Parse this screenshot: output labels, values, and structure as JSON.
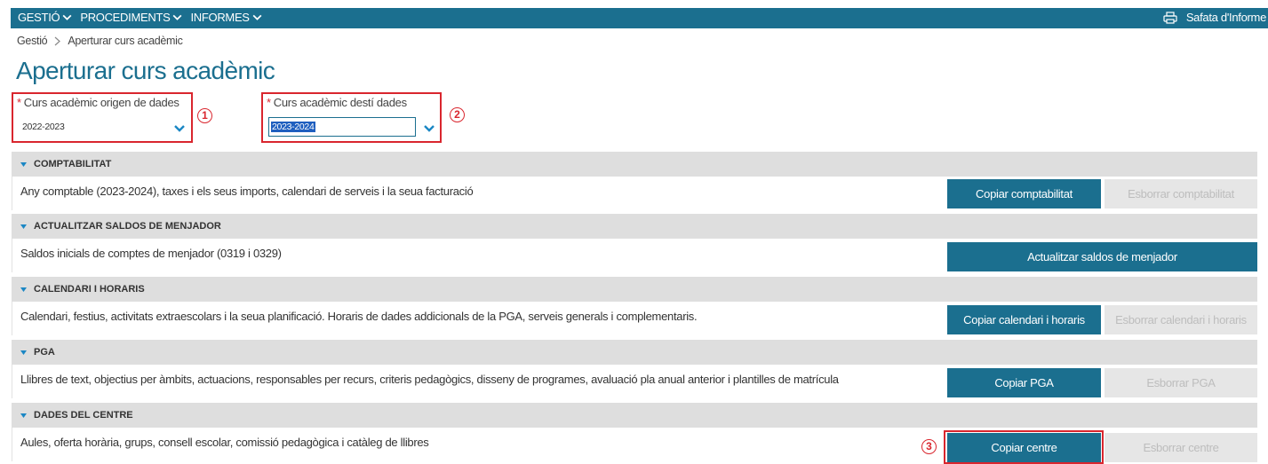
{
  "menu": {
    "items": [
      {
        "label": "GESTIÓ"
      },
      {
        "label": "PROCEDIMENTS"
      },
      {
        "label": "INFORMES"
      }
    ],
    "tray_label": "Safata d'Informe"
  },
  "breadcrumb": {
    "root": "Gestió",
    "current": "Aperturar curs acadèmic"
  },
  "page_title": "Aperturar curs acadèmic",
  "form": {
    "origin": {
      "label": "Curs acadèmic origen de dades",
      "value": "2022-2023",
      "required_mark": "*"
    },
    "target": {
      "label": "Curs acadèmic destí dades",
      "value": "2023-2024",
      "required_mark": "*"
    }
  },
  "annotations": [
    "1",
    "2",
    "3"
  ],
  "sections": [
    {
      "title": "COMPTABILITAT",
      "description": "Any comptable (2023-2024), taxes i els seus imports, calendari de serveis i la seua facturació",
      "primary_button": "Copiar comptabilitat",
      "secondary_button": "Esborrar comptabilitat"
    },
    {
      "title": "ACTUALITZAR SALDOS DE MENJADOR",
      "description": "Saldos inicials de comptes de menjador (0319 i 0329)",
      "primary_button": "Actualitzar saldos de menjador"
    },
    {
      "title": "CALENDARI I HORARIS",
      "description": "Calendari, festius, activitats extraescolars i la seua planificació. Horaris de dades addicionals de la PGA, serveis generals i complementaris.",
      "primary_button": "Copiar calendari i horaris",
      "secondary_button": "Esborrar calendari i horaris"
    },
    {
      "title": "PGA",
      "description": "Llibres de text, objectius per àmbits, actuacions, responsables per recurs, criteris pedagògics, disseny de programes, avaluació pla anual anterior i plantilles de matrícula",
      "primary_button": "Copiar PGA",
      "secondary_button": "Esborrar PGA"
    },
    {
      "title": "DADES DEL CENTRE",
      "description": "Aules, oferta horària, grups, consell escolar, comissió pedagògica i catàleg de llibres",
      "primary_button": "Copiar centre",
      "secondary_button": "Esborrar centre"
    }
  ],
  "colors": {
    "brand": "#1b6f8f",
    "highlight": "#d9262e",
    "section_header": "#dedede",
    "disabled_button": "#e6e6e6"
  }
}
